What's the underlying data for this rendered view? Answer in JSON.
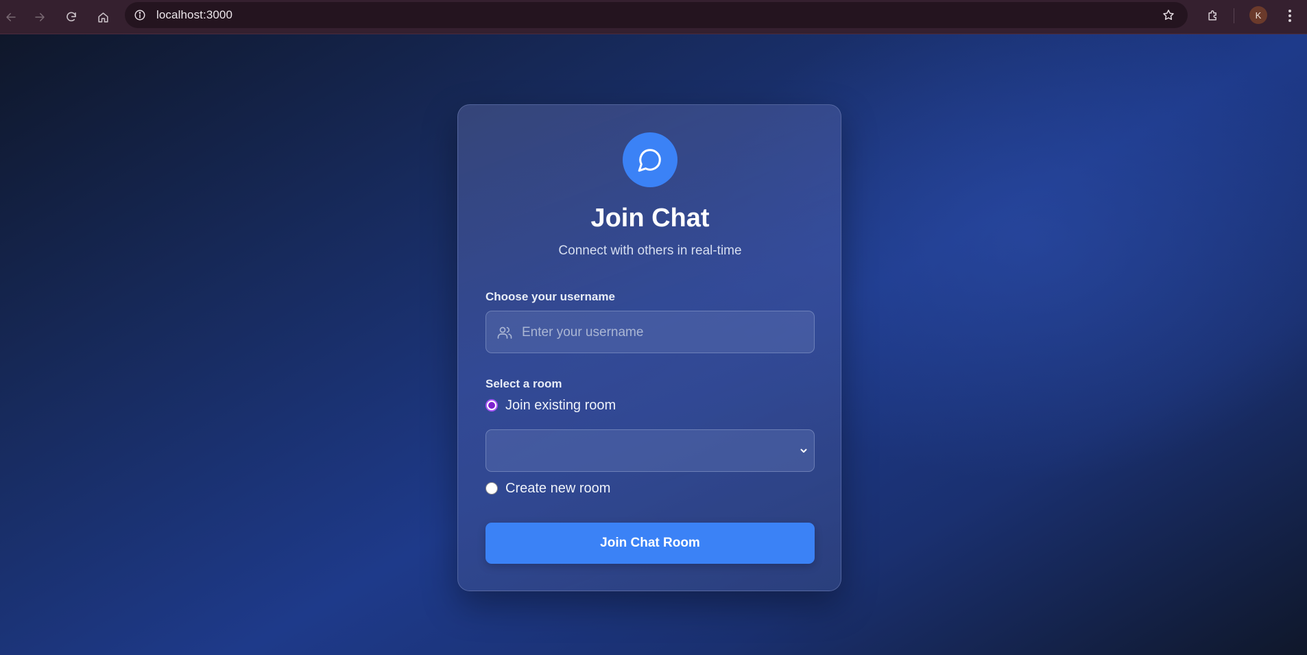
{
  "browser": {
    "url": "localhost:3000",
    "profile_initial": "K",
    "icons": {
      "back": "arrow-left-icon",
      "forward": "arrow-right-icon",
      "reload": "reload-icon",
      "home": "home-icon",
      "site_info": "info-icon",
      "bookmark": "star-icon",
      "extensions": "puzzle-icon",
      "menu": "kebab-menu-icon"
    }
  },
  "card": {
    "logo_icon": "chat-bubble-icon",
    "title": "Join Chat",
    "subtitle": "Connect with others in real-time",
    "username": {
      "label": "Choose your username",
      "placeholder": "Enter your username",
      "value": "",
      "icon": "users-icon"
    },
    "room": {
      "label": "Select a room",
      "options": [
        {
          "label": "Join existing room",
          "checked": true
        },
        {
          "label": "Create new room",
          "checked": false
        }
      ],
      "selected_room": ""
    },
    "submit_label": "Join Chat Room"
  },
  "colors": {
    "accent": "#3b82f6",
    "radio_accent": "#a855f7",
    "chrome_bg": "#35202f",
    "page_bg": "#1e3a8a"
  }
}
